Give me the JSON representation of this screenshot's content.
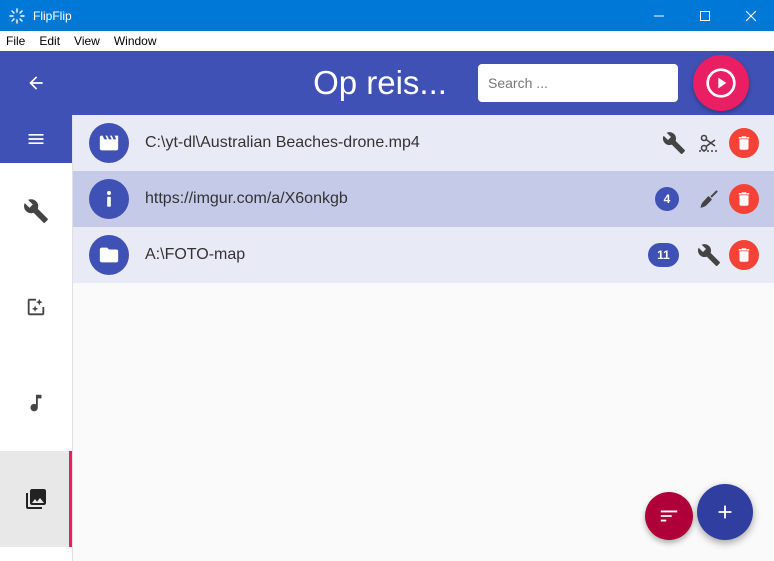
{
  "window": {
    "title": "FlipFlip",
    "controls": [
      "minimize-icon",
      "maximize-icon",
      "close-icon"
    ]
  },
  "menu": [
    "File",
    "Edit",
    "View",
    "Window"
  ],
  "appbar": {
    "title": "Op reis...",
    "search_placeholder": "Search ...",
    "back_icon": "arrow-left-icon",
    "play_icon": "play-circle-icon"
  },
  "drawer": {
    "items": [
      {
        "icon": "menu-icon"
      },
      {
        "icon": "wrench-icon"
      },
      {
        "icon": "add-image-icon"
      },
      {
        "icon": "music-note-icon"
      },
      {
        "icon": "photo-library-icon",
        "active": true
      }
    ]
  },
  "sources": [
    {
      "type": "video",
      "icon": "movie-icon",
      "path": "C:\\yt-dl\\Australian Beaches-drone.mp4",
      "count": null,
      "actions": [
        "wrench-icon",
        "clip-icon"
      ]
    },
    {
      "type": "url",
      "icon": "info-icon",
      "path": "https://imgur.com/a/X6onkgb",
      "count": "4",
      "actions": [
        "broom-icon"
      ],
      "selected": true
    },
    {
      "type": "folder",
      "icon": "folder-icon",
      "path": "A:\\FOTO-map",
      "count": "11",
      "actions": [
        "wrench-icon"
      ]
    }
  ],
  "fabs": {
    "sort_icon": "sort-icon",
    "add_icon": "plus-icon"
  },
  "colors": {
    "primary": "#3f51b5",
    "accent": "#e91e63",
    "delete": "#f44336",
    "titlebar": "#0078d7"
  }
}
